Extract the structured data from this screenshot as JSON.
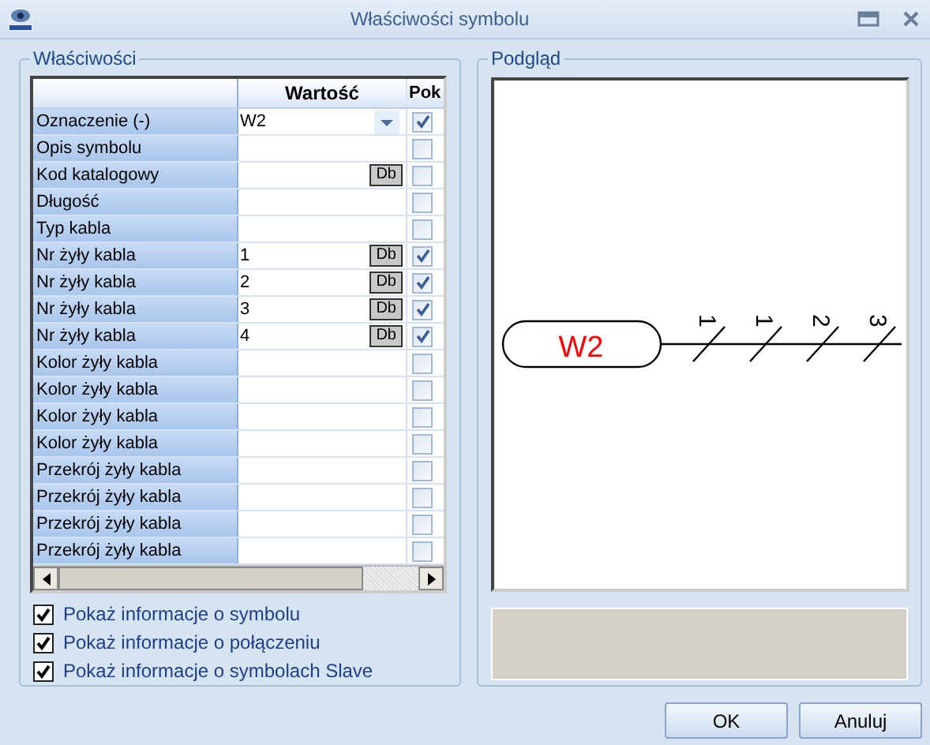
{
  "window": {
    "title": "Właściwości symbolu"
  },
  "properties": {
    "title": "Właściwości",
    "columns": [
      "Wartość",
      "Pok"
    ],
    "rows": [
      {
        "label": "Oznaczenie (-)",
        "value": "W2",
        "kind": "dropdown",
        "checked": true
      },
      {
        "label": "Opis symbolu",
        "kind": "plain",
        "checked": false
      },
      {
        "label": "Kod katalogowy",
        "kind": "db",
        "button": "Db",
        "checked": false
      },
      {
        "label": "Długość",
        "kind": "plain",
        "checked": false
      },
      {
        "label": "Typ kabla",
        "kind": "plain",
        "checked": false
      },
      {
        "label": "Nr żyły kabla",
        "value": "1",
        "kind": "db",
        "button": "Db",
        "checked": true
      },
      {
        "label": "Nr żyły kabla",
        "value": "2",
        "kind": "db",
        "button": "Db",
        "checked": true
      },
      {
        "label": "Nr żyły kabla",
        "value": "3",
        "kind": "db",
        "button": "Db",
        "checked": true
      },
      {
        "label": "Nr żyły kabla",
        "value": "4",
        "kind": "db",
        "button": "Db",
        "checked": true
      },
      {
        "label": "Kolor żyły kabla",
        "kind": "plain",
        "checked": false
      },
      {
        "label": "Kolor żyły kabla",
        "kind": "plain",
        "checked": false
      },
      {
        "label": "Kolor żyły kabla",
        "kind": "plain",
        "checked": false
      },
      {
        "label": "Kolor żyły kabla",
        "kind": "plain",
        "checked": false
      },
      {
        "label": "Przekrój żyły kabla",
        "kind": "plain",
        "checked": false
      },
      {
        "label": "Przekrój żyły kabla",
        "kind": "plain",
        "checked": false
      },
      {
        "label": "Przekrój żyły kabla",
        "kind": "plain",
        "checked": false
      },
      {
        "label": "Przekrój żyły kabla",
        "kind": "plain",
        "checked": false
      }
    ],
    "options": [
      {
        "label": "Pokaż informacje o symbolu",
        "checked": true
      },
      {
        "label": "Pokaż informacje o połączeniu",
        "checked": true
      },
      {
        "label": "Pokaż informacje o symbolach Slave",
        "checked": true
      }
    ]
  },
  "preview": {
    "title": "Podgląd",
    "symbol": "W2",
    "wires": [
      "1",
      "1",
      "2",
      "3"
    ]
  },
  "buttons": [
    "OK",
    "Anuluj"
  ]
}
